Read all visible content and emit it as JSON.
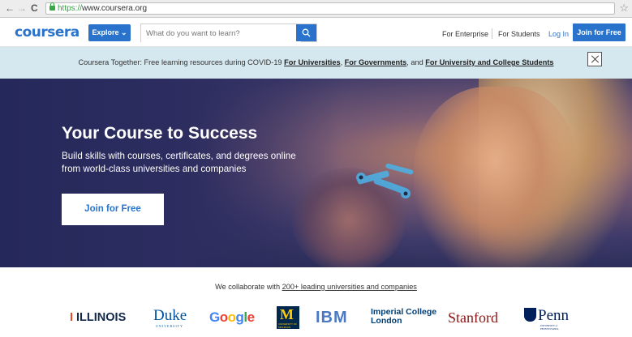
{
  "browser": {
    "back": "←",
    "forward": "→",
    "reload": "C",
    "url_scheme": "https://",
    "url_rest": "www.coursera.org",
    "star": "☆"
  },
  "header": {
    "logo": "coursera",
    "explore_label": "Explore ⌄",
    "search_placeholder": "What do you want to learn?",
    "links": {
      "enterprise": "For Enterprise",
      "students": "For Students",
      "login": "Log In",
      "join": "Join for Free"
    },
    "accent": "#2a73cc"
  },
  "banner": {
    "prefix": "Coursera Together: Free learning resources during COVID-19 ",
    "link1": "For Universities",
    "sep1": ", ",
    "link2": "For Governments",
    "sep2": ", and ",
    "link3": "For University and College Students",
    "background": "#d5e8ef"
  },
  "hero": {
    "title": "Your Course to Success",
    "subtitle": "Build skills with courses, certificates, and degrees online from world-class universities and companies",
    "cta": "Join for Free"
  },
  "partners": {
    "prefix": "We collaborate with ",
    "link": "200+ leading universities and companies",
    "logos": {
      "illinois": "ILLINOIS",
      "illinois_mark": "I",
      "duke": "Duke",
      "duke_sub": "UNIVERSITY",
      "google": "Google",
      "michigan": "M",
      "michigan_sub": "UNIVERSITY OF MICHIGAN",
      "ibm": "IBM",
      "imperial_line1": "Imperial College",
      "imperial_line2": "London",
      "stanford": "Stanford",
      "penn": "Penn",
      "penn_sub": "UNIVERSITY of PENNSYLVANIA"
    }
  }
}
